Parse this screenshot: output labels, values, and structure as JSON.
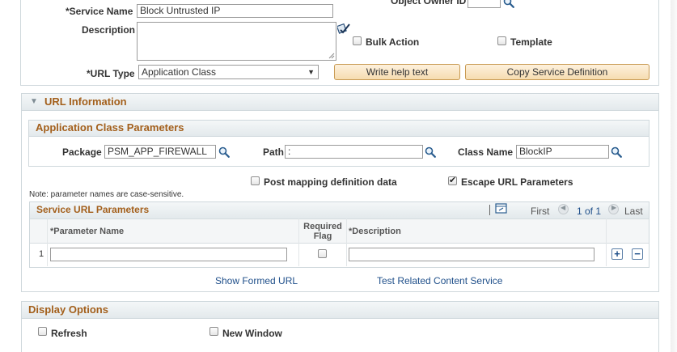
{
  "form": {
    "service_name_label": "*Service Name",
    "service_name_value": "Block Untrusted IP",
    "object_owner_label": "Object Owner ID",
    "description_label": "Description",
    "bulk_action_label": "Bulk Action",
    "template_label": "Template",
    "url_type_label": "*URL Type",
    "url_type_value": "Application Class",
    "write_help_button": "Write help text",
    "copy_service_button": "Copy Service Definition"
  },
  "url_info": {
    "title": "URL Information",
    "app_class_params_title": "Application Class Parameters",
    "package_label": "Package",
    "package_value": "PSM_APP_FIREWALL",
    "path_label": "Path",
    "path_value": ":",
    "class_name_label": "Class Name",
    "class_name_value": "BlockIP",
    "post_mapping_label": "Post mapping definition data",
    "escape_url_label": "Escape URL Parameters",
    "note": "Note: parameter names are case-sensitive.",
    "grid": {
      "title": "Service URL Parameters",
      "nav_first": "First",
      "nav_count": "1 of 1",
      "nav_last": "Last",
      "col_param_name": "*Parameter Name",
      "col_required": "Required Flag",
      "col_description": "*Description",
      "rows": [
        {
          "num": "1",
          "param_name": "",
          "required": false,
          "description": ""
        }
      ]
    },
    "show_formed_url_link": "Show Formed URL",
    "test_related_link": "Test Related Content Service"
  },
  "display_options": {
    "title": "Display Options",
    "refresh_label": "Refresh",
    "new_window_label": "New Window"
  },
  "icons": {
    "lookup": "magnifier-icon",
    "spellcheck": "spell-check-icon",
    "expand": "triangle-down-icon",
    "personalize": "grid-personalize-icon",
    "add": "plus-icon",
    "remove": "minus-icon"
  },
  "colors": {
    "section_title": "#a35f1b",
    "link": "#1f4f8a",
    "button_bg": "#f6dcb0"
  }
}
